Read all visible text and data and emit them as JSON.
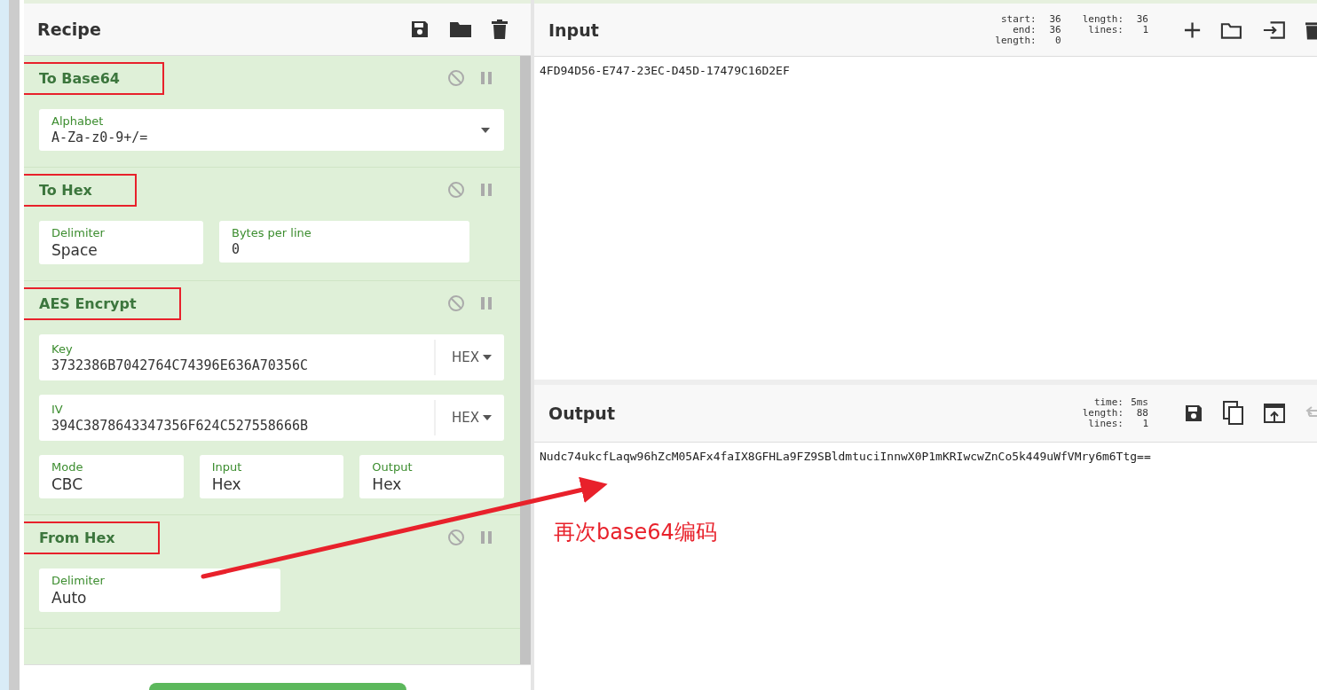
{
  "recipe": {
    "title": "Recipe",
    "operations": [
      {
        "title": "To Base64",
        "highlighted": true,
        "rows": [
          [
            {
              "kind": "editable-select",
              "label": "Alphabet",
              "value": "A-Za-z0-9+/="
            }
          ]
        ]
      },
      {
        "title": "To Hex",
        "highlighted": true,
        "rows": [
          [
            {
              "kind": "select",
              "label": "Delimiter",
              "value": "Space"
            },
            {
              "kind": "text",
              "label": "Bytes per line",
              "value": "0"
            }
          ]
        ]
      },
      {
        "title": "AES Encrypt",
        "highlighted": true,
        "rows": [
          [
            {
              "kind": "keyed",
              "label": "Key",
              "value": "3732386B7042764C74396E636A70356C",
              "option": "HEX"
            }
          ],
          [
            {
              "kind": "keyed",
              "label": "IV",
              "value": "394C3878643347356F624C527558666B",
              "option": "HEX"
            }
          ],
          [
            {
              "kind": "select",
              "label": "Mode",
              "value": "CBC"
            },
            {
              "kind": "select",
              "label": "Input",
              "value": "Hex"
            },
            {
              "kind": "select",
              "label": "Output",
              "value": "Hex"
            }
          ]
        ]
      },
      {
        "title": "From Hex",
        "highlighted": true,
        "rows": [
          [
            {
              "kind": "select",
              "label": "Delimiter",
              "value": "Auto"
            }
          ]
        ]
      }
    ]
  },
  "input": {
    "title": "Input",
    "stats": [
      [
        "start:",
        "36"
      ],
      [
        "end:",
        "36"
      ],
      [
        "length:",
        "0"
      ]
    ],
    "stats2": [
      [
        "length:",
        "36"
      ],
      [
        "lines:",
        "1"
      ]
    ],
    "text": "4FD94D56-E747-23EC-D45D-17479C16D2EF"
  },
  "output": {
    "title": "Output",
    "stats": [
      [
        "time:",
        "5ms"
      ],
      [
        "length:",
        "88"
      ],
      [
        "lines:",
        "1"
      ]
    ],
    "text": "Nudc74ukcfLaqw96hZcM05AFx4faIX8GFHLa9FZ9SBldmtuciInnwX0P1mKRIwcwZnCo5k449uWfVMry6m6Ttg=="
  },
  "annotation": {
    "text": "再次base64编码"
  }
}
